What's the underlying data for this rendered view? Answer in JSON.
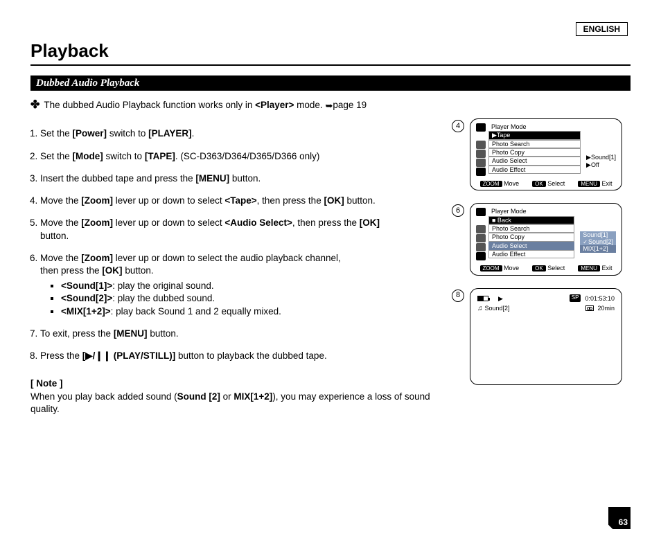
{
  "language": "ENGLISH",
  "title": "Playback",
  "subtitle": "Dubbed Audio Playback",
  "intro": {
    "text_prefix": "The dubbed Audio Playback function works only in ",
    "mode": "<Player>",
    "text_suffix": " mode. ",
    "page_ref": "page 19"
  },
  "steps": {
    "s1": {
      "a": "Set the ",
      "b": "[Power]",
      "c": " switch to ",
      "d": "[PLAYER]",
      "e": "."
    },
    "s2": {
      "a": "Set the ",
      "b": "[Mode]",
      "c": " switch to ",
      "d": "[TAPE]",
      "e": ". (SC-D363/D364/D365/D366 only)"
    },
    "s3": {
      "a": "Insert the dubbed tape and press the ",
      "b": "[MENU]",
      "c": " button."
    },
    "s4": {
      "a": "Move the ",
      "b": "[Zoom]",
      "c": " lever up or down to select ",
      "d": "<Tape>",
      "e": ", then press the ",
      "f": "[OK]",
      "g": " button."
    },
    "s5": {
      "a": "Move the ",
      "b": "[Zoom]",
      "c": " lever up or down to select ",
      "d": "<Audio Select>",
      "e": ", then press the ",
      "f": "[OK]",
      "g": " button."
    },
    "s6": {
      "a": "Move the ",
      "b": "[Zoom]",
      "c": " lever up or down to select the audio playback channel,",
      "d": "then press the ",
      "e": "[OK]",
      "f": " button.",
      "sub1": {
        "opt": "<Sound[1]>",
        "desc": ": play the original sound."
      },
      "sub2": {
        "opt": "<Sound[2]>",
        "desc": ": play the dubbed sound."
      },
      "sub3": {
        "opt": "<MIX[1+2]>",
        "desc": ": play back Sound 1 and 2 equally mixed."
      }
    },
    "s7": {
      "a": "To exit, press the ",
      "b": "[MENU]",
      "c": " button."
    },
    "s8": {
      "a": "Press the ",
      "b": "[▶/❙❙ (PLAY/STILL)]",
      "c": " button to playback the dubbed tape."
    }
  },
  "note": {
    "label": "[ Note ]",
    "text_a": "When you play back added sound (",
    "text_b": "Sound [2]",
    "text_c": " or ",
    "text_d": "MIX[1+2]",
    "text_e": "), you may experience a loss of sound quality."
  },
  "diagrams": {
    "d4": {
      "num": "4",
      "title": "Player Mode",
      "tape": "▶Tape",
      "items": [
        "Photo Search",
        "Photo Copy",
        "Audio Select",
        "Audio Effect"
      ],
      "side": [
        "▶Sound[1]",
        "▶Off"
      ],
      "bottom": {
        "zoom": "ZOOM",
        "move": "Move",
        "ok": "OK",
        "select": "Select",
        "menu": "MENU",
        "exit": "Exit"
      }
    },
    "d6": {
      "num": "6",
      "title": "Player Mode",
      "back": "■ Back",
      "items": [
        "Photo Search",
        "Photo Copy",
        "Audio Select",
        "Audio Effect"
      ],
      "options": [
        "Sound[1]",
        "Sound[2]",
        "MIX[1+2]"
      ],
      "bottom": {
        "zoom": "ZOOM",
        "move": "Move",
        "ok": "OK",
        "select": "Select",
        "menu": "MENU",
        "exit": "Exit"
      }
    },
    "d8": {
      "num": "8",
      "sound": "Sound[2]",
      "sp": "SP",
      "timecode": "0:01:53:10",
      "remain": "20min"
    }
  },
  "page_number": "63"
}
